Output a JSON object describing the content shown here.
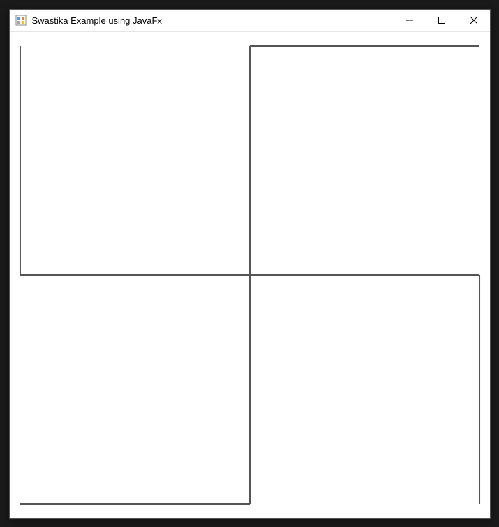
{
  "window": {
    "title": "Swastika Example using JavaFx",
    "controls": {
      "minimize_tooltip": "Minimize",
      "maximize_tooltip": "Maximize",
      "close_tooltip": "Close"
    }
  },
  "canvas": {
    "stroke_color": "#555555",
    "stroke_width": 2,
    "background": "#ffffff"
  }
}
